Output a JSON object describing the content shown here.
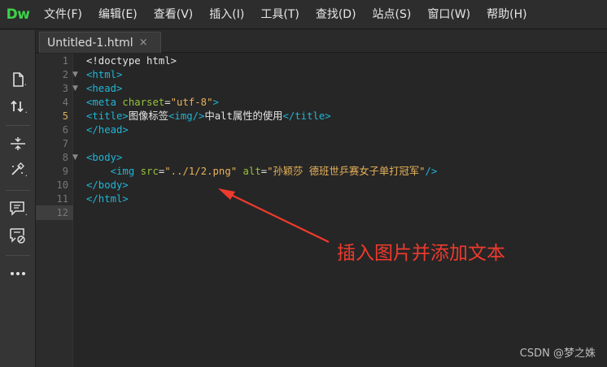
{
  "app": {
    "logo": "Dw"
  },
  "menu": [
    "文件(F)",
    "编辑(E)",
    "查看(V)",
    "插入(I)",
    "工具(T)",
    "查找(D)",
    "站点(S)",
    "窗口(W)",
    "帮助(H)"
  ],
  "tab": {
    "title": "Untitled-1.html",
    "close": "×"
  },
  "toolbar_icons": [
    "new-file-icon",
    "sort-arrows-icon",
    "expand-collapse-icon",
    "wand-icon",
    "comment-icon",
    "uncomment-icon",
    "more-icon"
  ],
  "editor": {
    "active_line": 12,
    "lines": [
      {
        "n": "1",
        "fold": "",
        "tokens": [
          {
            "c": "t-txt",
            "t": "<!doctype html>"
          }
        ]
      },
      {
        "n": "2",
        "fold": "▼",
        "tokens": [
          {
            "c": "t-tag",
            "t": "<html>"
          }
        ]
      },
      {
        "n": "3",
        "fold": "▼",
        "tokens": [
          {
            "c": "t-tag",
            "t": "<head>"
          }
        ]
      },
      {
        "n": "4",
        "fold": "",
        "tokens": [
          {
            "c": "t-tag",
            "t": "<meta "
          },
          {
            "c": "t-attr",
            "t": "charset"
          },
          {
            "c": "t-txt",
            "t": "="
          },
          {
            "c": "t-val",
            "t": "\"utf-8\""
          },
          {
            "c": "t-tag",
            "t": ">"
          }
        ]
      },
      {
        "n": "5",
        "fold": "",
        "tokens": [
          {
            "c": "t-tag",
            "t": "<title>"
          },
          {
            "c": "t-txt",
            "t": "图像标签"
          },
          {
            "c": "t-tag",
            "t": "<img/>"
          },
          {
            "c": "t-txt",
            "t": "中alt属性的使用"
          },
          {
            "c": "t-tag",
            "t": "</title>"
          }
        ]
      },
      {
        "n": "6",
        "fold": "",
        "tokens": [
          {
            "c": "t-tag",
            "t": "</head>"
          }
        ]
      },
      {
        "n": "7",
        "fold": "",
        "tokens": []
      },
      {
        "n": "8",
        "fold": "▼",
        "tokens": [
          {
            "c": "t-tag",
            "t": "<body>"
          }
        ]
      },
      {
        "n": "9",
        "fold": "",
        "tokens": [
          {
            "c": "t-txt",
            "t": "    "
          },
          {
            "c": "t-tag",
            "t": "<img "
          },
          {
            "c": "t-attr",
            "t": "src"
          },
          {
            "c": "t-txt",
            "t": "="
          },
          {
            "c": "t-val",
            "t": "\"../1/2.png\""
          },
          {
            "c": "t-txt",
            "t": " "
          },
          {
            "c": "t-attr",
            "t": "alt"
          },
          {
            "c": "t-txt",
            "t": "="
          },
          {
            "c": "t-val",
            "t": "\"孙颖莎 德班世乒赛女子单打冠军\""
          },
          {
            "c": "t-tag",
            "t": "/>"
          }
        ]
      },
      {
        "n": "10",
        "fold": "",
        "tokens": [
          {
            "c": "t-tag",
            "t": "</body>"
          }
        ]
      },
      {
        "n": "11",
        "fold": "",
        "tokens": [
          {
            "c": "t-tag",
            "t": "</html>"
          }
        ]
      },
      {
        "n": "12",
        "fold": "",
        "tokens": []
      }
    ]
  },
  "annotation": {
    "text": "插入图片并添加文本",
    "color": "#ef3a2d"
  },
  "watermark": "CSDN @梦之姝",
  "colors": {
    "logo": "#3fd14a",
    "tag": "#1fb6d6",
    "attr": "#97c23a",
    "value": "#e8b35a"
  }
}
